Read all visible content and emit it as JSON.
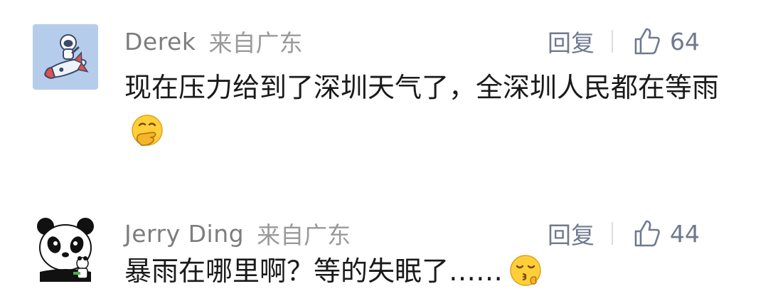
{
  "comments": [
    {
      "nickname": "Derek",
      "region": "来自广东",
      "reply_label": "回复",
      "like_count": "64",
      "text": "现在压力给到了深圳天气了，全深圳人民都在等雨",
      "emoji": "hand-over-mouth-emoji",
      "avatar": "astronaut-rocket-avatar"
    },
    {
      "nickname": "Jerry Ding",
      "region": "来自广东",
      "reply_label": "回复",
      "like_count": "44",
      "text": "暴雨在哪里啊？等的失眠了……",
      "emoji": "kissing-smiling-eyes-emoji",
      "avatar": "panda-avatar"
    }
  ],
  "icons": {
    "like": "thumbs-up-icon"
  },
  "colors": {
    "nickname": "#7d7d7d",
    "action": "#6f7a8f",
    "avatar_bg": "#b5cdeb",
    "text": "#1a1a1a"
  }
}
